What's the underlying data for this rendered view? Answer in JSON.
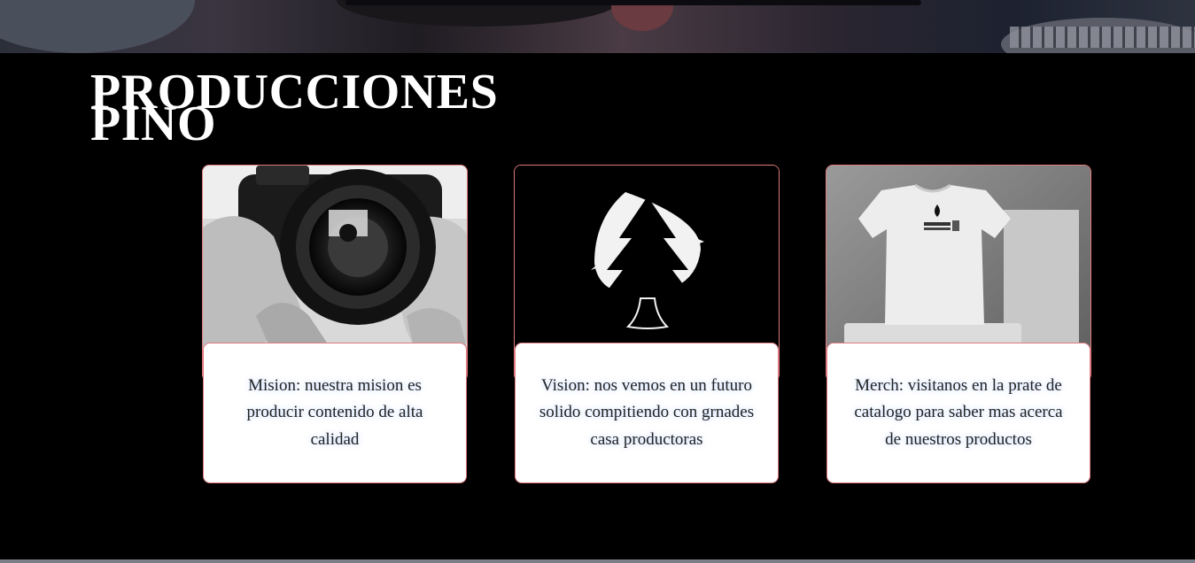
{
  "hero": {
    "alt": "Banner image"
  },
  "brand": {
    "line1": "PRODUCCIONES",
    "line2": "PINO"
  },
  "cards": [
    {
      "image": "camera-photo",
      "text": "Mision: nuestra mision es producir contenido de alta calidad"
    },
    {
      "image": "pine-tree-logo",
      "text": "Vision: nos vemos en un futuro solido compitiendo con grnades casa productoras"
    },
    {
      "image": "tshirt-photo",
      "text": "Merch: visitanos en la prate de catalogo para saber mas acerca de nuestros productos"
    }
  ],
  "colors": {
    "background": "#000000",
    "card_border": "#e07a80",
    "text": "#222222"
  }
}
